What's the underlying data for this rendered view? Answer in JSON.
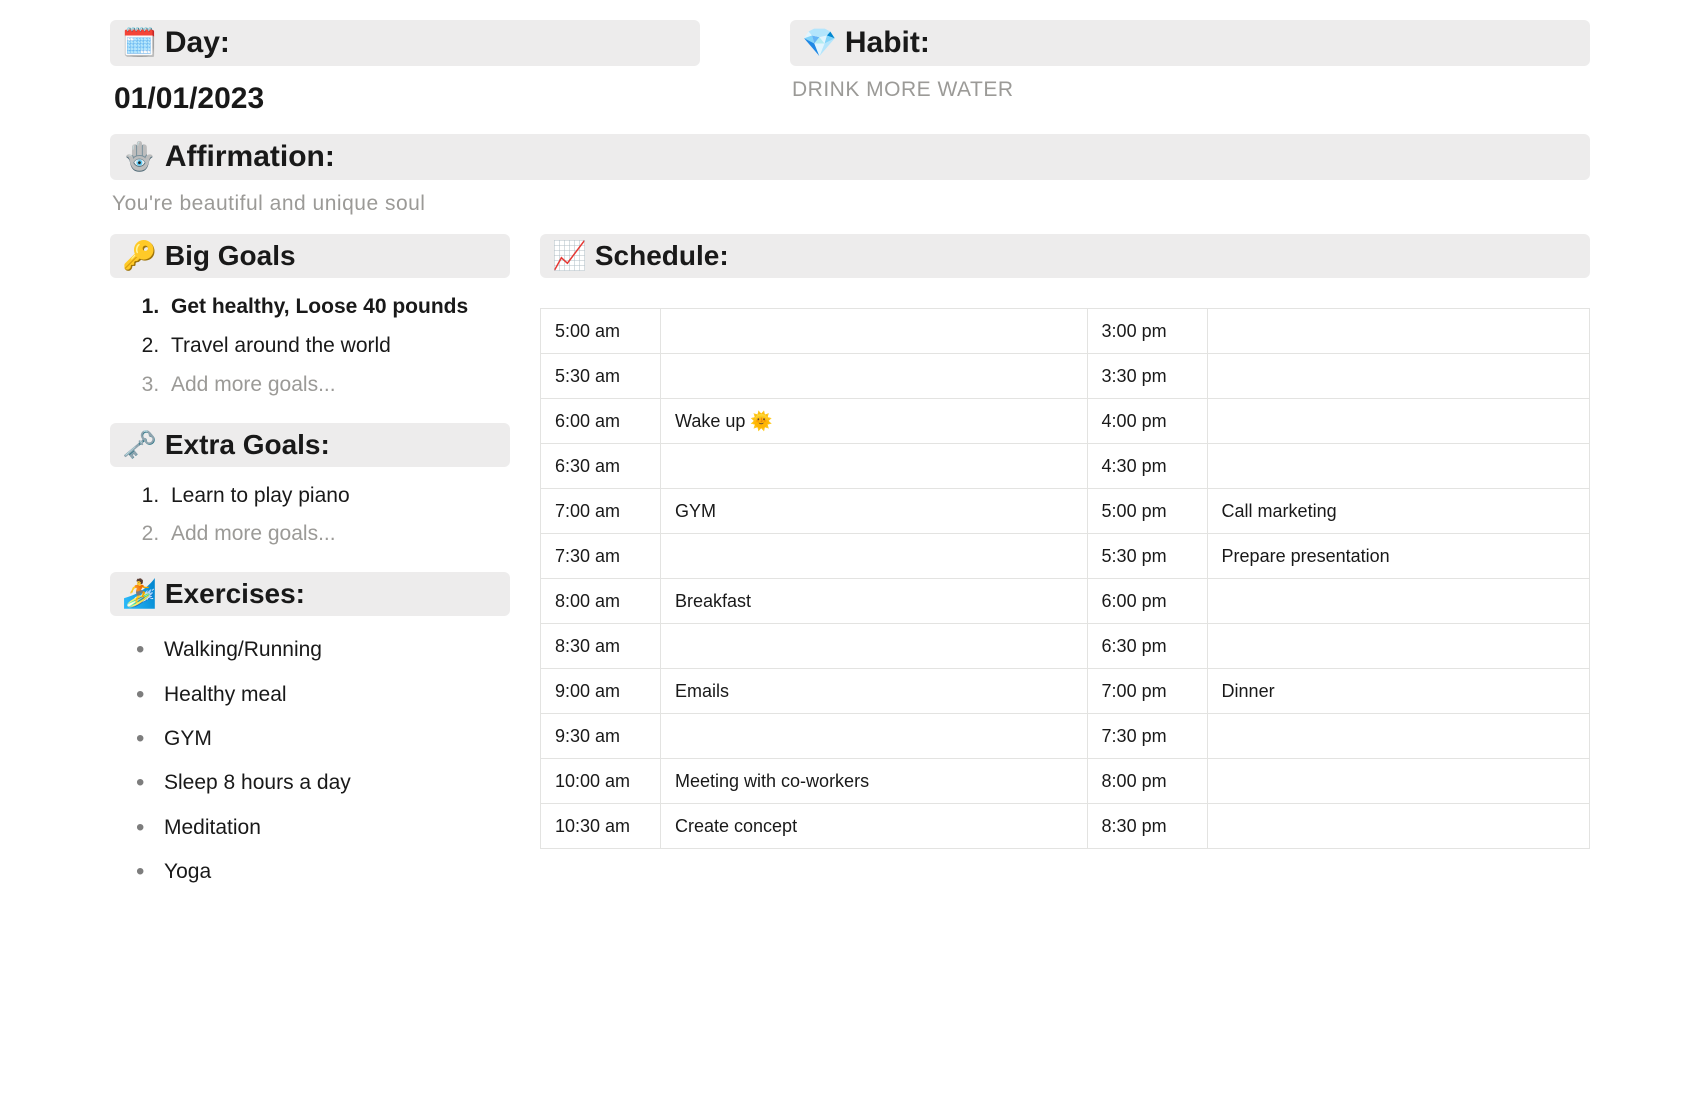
{
  "day": {
    "icon": "🗓️",
    "label": "Day:",
    "value": "01/01/2023"
  },
  "habit": {
    "icon": "💎",
    "label": "Habit:",
    "value": "DRINK MORE WATER"
  },
  "affirmation": {
    "icon": "🪬",
    "label": "Affirmation:",
    "value": "You're beautiful and unique soul"
  },
  "big_goals": {
    "icon": "🔑",
    "label": "Big Goals",
    "items": [
      {
        "text": "Get healthy, Loose 40 pounds",
        "bold": true
      },
      {
        "text": "Travel around the world",
        "bold": false
      },
      {
        "text": "Add more goals...",
        "placeholder": true
      }
    ]
  },
  "extra_goals": {
    "icon": "🗝️",
    "label": "Extra Goals:",
    "items": [
      {
        "text": "Learn to play piano",
        "bold": false
      },
      {
        "text": "Add more goals...",
        "placeholder": true
      }
    ]
  },
  "exercises": {
    "icon": "🏄",
    "label": "Exercises:",
    "items": [
      "Walking/Running",
      "Healthy meal",
      "GYM",
      "Sleep 8 hours a day",
      "Meditation",
      "Yoga"
    ]
  },
  "schedule": {
    "icon": "📈",
    "label": "Schedule:",
    "rows": [
      {
        "am_time": "5:00 am",
        "am_act": "",
        "pm_time": "3:00 pm",
        "pm_act": ""
      },
      {
        "am_time": "5:30 am",
        "am_act": "",
        "pm_time": "3:30 pm",
        "pm_act": ""
      },
      {
        "am_time": "6:00 am",
        "am_act": "Wake up 🌞",
        "pm_time": "4:00 pm",
        "pm_act": ""
      },
      {
        "am_time": "6:30 am",
        "am_act": "",
        "pm_time": "4:30 pm",
        "pm_act": ""
      },
      {
        "am_time": "7:00 am",
        "am_act": "GYM",
        "pm_time": "5:00 pm",
        "pm_act": "Call marketing"
      },
      {
        "am_time": "7:30 am",
        "am_act": "",
        "pm_time": "5:30 pm",
        "pm_act": "Prepare presentation"
      },
      {
        "am_time": "8:00 am",
        "am_act": "Breakfast",
        "pm_time": "6:00 pm",
        "pm_act": ""
      },
      {
        "am_time": "8:30 am",
        "am_act": "",
        "pm_time": "6:30 pm",
        "pm_act": ""
      },
      {
        "am_time": "9:00 am",
        "am_act": "Emails",
        "pm_time": "7:00 pm",
        "pm_act": "Dinner"
      },
      {
        "am_time": "9:30 am",
        "am_act": "",
        "pm_time": "7:30 pm",
        "pm_act": ""
      },
      {
        "am_time": "10:00 am",
        "am_act": "Meeting with co-workers",
        "pm_time": "8:00 pm",
        "pm_act": ""
      },
      {
        "am_time": "10:30 am",
        "am_act": "Create concept",
        "pm_time": "8:30 pm",
        "pm_act": ""
      }
    ]
  }
}
